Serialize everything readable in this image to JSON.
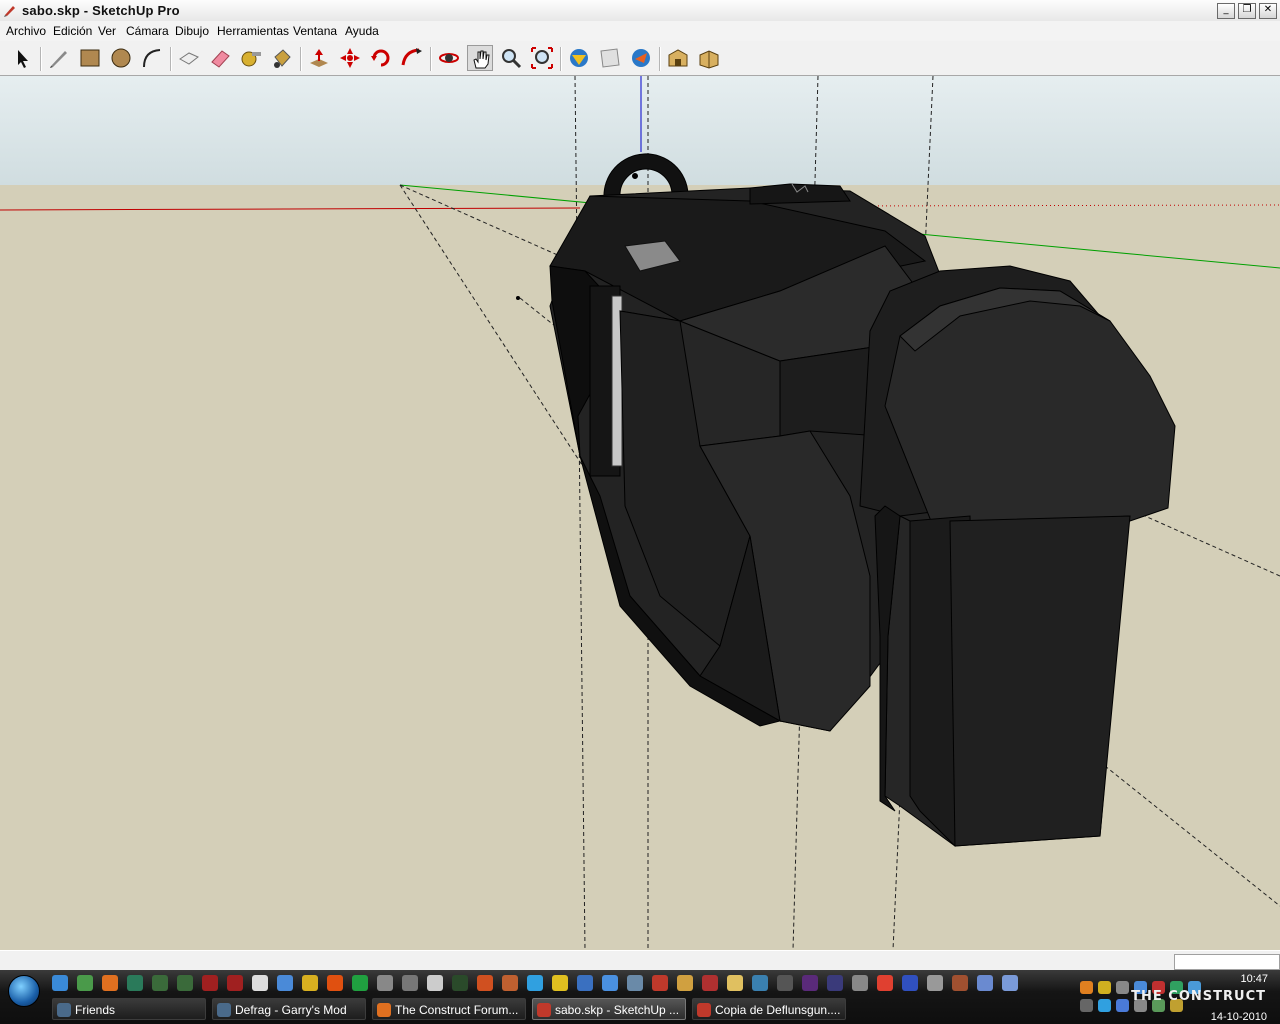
{
  "window": {
    "title": "sabo.skp - SketchUp Pro"
  },
  "menu": [
    "Archivo",
    "Edición",
    "Ver",
    "Cámara",
    "Dibujo",
    "Herramientas",
    "Ventana",
    "Ayuda"
  ],
  "toolbar": {
    "tools": [
      "select",
      "line",
      "rectangle",
      "circle",
      "arc",
      "make-component",
      "eraser",
      "tape-measure",
      "paint-bucket",
      "push-pull",
      "move",
      "rotate",
      "follow-me",
      "orbit",
      "pan",
      "zoom",
      "zoom-extents",
      "get-models",
      "share-model",
      "share-component",
      "warehouse",
      "extension"
    ],
    "active_tool": "pan"
  },
  "colors": {
    "sky": "#dde8ec",
    "ground": "#d4cfb8",
    "model": "#1f1f1f",
    "red_axis": "#c00000",
    "green_axis": "#00a000",
    "blue_axis": "#0000cc"
  },
  "taskbar": {
    "tasks": [
      {
        "label": "Friends",
        "icon": "steam-icon"
      },
      {
        "label": "Defrag - Garry's Mod",
        "icon": "steam-icon"
      },
      {
        "label": "The Construct Forum...",
        "icon": "firefox-icon"
      },
      {
        "label": "sabo.skp - SketchUp ...",
        "icon": "sketchup-icon",
        "active": true
      },
      {
        "label": "Copia de Deflunsgun....",
        "icon": "sketchup-icon"
      }
    ],
    "clock": "10:47",
    "date": "14-10-2010",
    "watermark": "THE CONSTRUCT"
  }
}
